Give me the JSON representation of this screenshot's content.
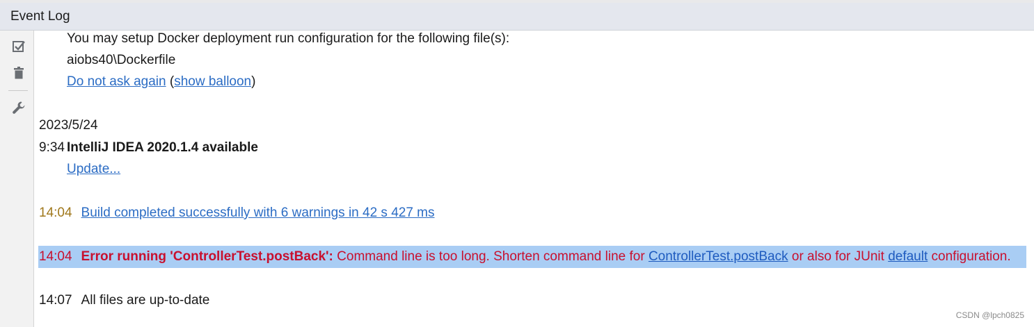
{
  "panel": {
    "title": "Event Log"
  },
  "toolbar": {
    "mark_read_icon": "checkbox-check-icon",
    "clear_icon": "trash-icon",
    "settings_icon": "wrench-icon"
  },
  "entries": {
    "docker": {
      "message": "You may setup Docker deployment run configuration for the following file(s):",
      "file": "aiobs40\\Dockerfile",
      "do_not_ask_link": "Do not ask again",
      "paren_open": " (",
      "show_balloon_link": "show balloon",
      "paren_close": ")"
    },
    "date_header": "2023/5/24",
    "update": {
      "time": "9:34",
      "title": "IntelliJ IDEA 2020.1.4 available",
      "update_link": "Update..."
    },
    "build": {
      "time": "14:04",
      "message_link": "Build completed successfully with 6 warnings in 42 s 427 ms"
    },
    "error": {
      "time": "14:04",
      "title": "Error running 'ControllerTest.postBack':",
      "message_part1": " Command line is too long. Shorten command line for ",
      "link1": "ControllerTest.postBack",
      "message_part2": " or also for JUnit ",
      "link2": "default",
      "message_part3": " configuration."
    },
    "uptodate": {
      "time": "14:07",
      "message": "All files are up-to-date"
    }
  },
  "watermark": "CSDN @lpch0825",
  "colors": {
    "link": "#2b6cc4",
    "error": "#c8102e",
    "warning_time": "#a0781c",
    "selection": "#a9cdf4"
  }
}
